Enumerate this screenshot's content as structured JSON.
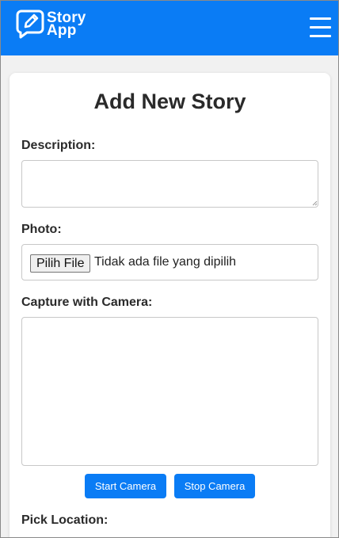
{
  "header": {
    "logo_line1": "Story",
    "logo_line2": "App",
    "menu_icon": "hamburger-menu-icon",
    "logo_icon": "chat-pencil-icon",
    "background_color": "#0a7cf5"
  },
  "form": {
    "title": "Add New Story",
    "description_label": "Description:",
    "description_value": "",
    "photo_label": "Photo:",
    "file_button_label": "Pilih File",
    "file_status": "Tidak ada file yang dipilih",
    "camera_label": "Capture with Camera:",
    "start_camera_label": "Start Camera",
    "stop_camera_label": "Stop Camera",
    "location_label": "Pick Location:"
  },
  "colors": {
    "accent": "#0a7cf5",
    "card_background": "#ffffff",
    "page_background": "#f1f1f1"
  }
}
